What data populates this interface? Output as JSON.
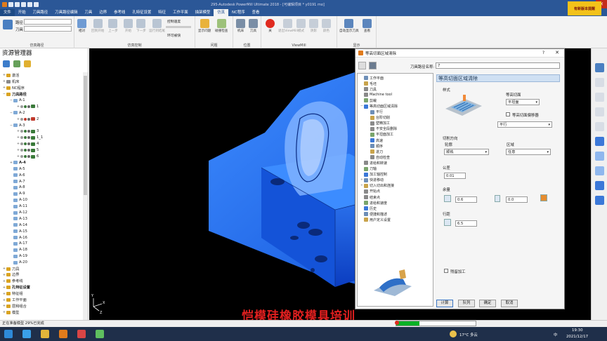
{
  "app": {
    "title": "295-Autodesk PowerMill Ultimate 2018  -  [可编辑项目 * y0191 mo]",
    "brand_banner": "有新版本提醒"
  },
  "menu": {
    "tabs": [
      "文件",
      "开始",
      "刀具路径",
      "刀具路径编辑",
      "刀具",
      "边界",
      "参考线",
      "孔特征设置",
      "特征",
      "工作平面",
      "描架模型",
      "仿真",
      "NC程序",
      "查看"
    ]
  },
  "ribbon": {
    "group_sim_path": {
      "label": "仿真路径",
      "row1": "路径",
      "row2": "刀具"
    },
    "group_sim_ctrl": {
      "label": "仿真控制",
      "buttons": [
        "相对",
        "回到开始",
        "上一步",
        "开始",
        "下一步",
        "运行到结尾"
      ],
      "speed": "控制速度",
      "loop": "环可被快"
    },
    "group_issue": {
      "label": "问题",
      "buttons": [
        "显示问题",
        "碰撞检查"
      ]
    },
    "group_pos": {
      "label": "位置",
      "buttons": [
        "机床",
        "刀具"
      ]
    },
    "group_viewmill": {
      "label": "ViewMill",
      "buttons": [
        "关",
        "退出ViewMill",
        "模式",
        "阴影",
        "颜色"
      ]
    },
    "group_display": {
      "label": "显示",
      "buttons": [
        "自动显示刀具",
        "查看"
      ]
    }
  },
  "explorer": {
    "title": "资源管理器",
    "items": [
      {
        "label": "激活",
        "depth": 0,
        "exp": "+",
        "c": "#d9a321"
      },
      {
        "label": "机床",
        "depth": 0,
        "exp": "+",
        "c": "#8a8a8a"
      },
      {
        "label": "NC程序",
        "depth": 0,
        "exp": "+",
        "c": "#d9a321"
      },
      {
        "label": "刀具路径",
        "depth": 0,
        "exp": "−",
        "c": "#d9a321",
        "bold": true
      },
      {
        "label": "A-1",
        "depth": 1,
        "exp": "−",
        "c": "#7fa9d6"
      },
      {
        "label": "1",
        "depth": 2,
        "exp": "+",
        "c": "#3a7a3a",
        "marks": true
      },
      {
        "label": "A-2",
        "depth": 1,
        "exp": "−",
        "c": "#7fa9d6"
      },
      {
        "label": "2",
        "depth": 2,
        "exp": "+",
        "c": "#c0392b",
        "marks": true
      },
      {
        "label": "A-3",
        "depth": 1,
        "exp": "−",
        "c": "#7fa9d6"
      },
      {
        "label": "3",
        "depth": 2,
        "exp": "+",
        "c": "#3a7a3a",
        "marks": true
      },
      {
        "label": "1_1",
        "depth": 2,
        "exp": "+",
        "c": "#3a7a3a",
        "marks": true
      },
      {
        "label": "4",
        "depth": 2,
        "exp": "+",
        "c": "#3a7a3a",
        "marks": true
      },
      {
        "label": "5",
        "depth": 2,
        "exp": "+",
        "c": "#3a7a3a",
        "marks": true
      },
      {
        "label": "6",
        "depth": 2,
        "exp": "+",
        "c": "#3a7a3a",
        "marks": true
      },
      {
        "label": "A-4",
        "depth": 1,
        "exp": "+",
        "c": "#7fa9d6",
        "bold": true
      },
      {
        "label": "A-5",
        "depth": 1,
        "exp": "",
        "c": "#7fa9d6"
      },
      {
        "label": "A-6",
        "depth": 1,
        "exp": "",
        "c": "#7fa9d6"
      },
      {
        "label": "A-7",
        "depth": 1,
        "exp": "",
        "c": "#7fa9d6"
      },
      {
        "label": "A-8",
        "depth": 1,
        "exp": "",
        "c": "#7fa9d6"
      },
      {
        "label": "A-9",
        "depth": 1,
        "exp": "",
        "c": "#7fa9d6"
      },
      {
        "label": "A-10",
        "depth": 1,
        "exp": "",
        "c": "#7fa9d6"
      },
      {
        "label": "A-11",
        "depth": 1,
        "exp": "",
        "c": "#7fa9d6"
      },
      {
        "label": "A-12",
        "depth": 1,
        "exp": "",
        "c": "#7fa9d6"
      },
      {
        "label": "A-13",
        "depth": 1,
        "exp": "",
        "c": "#7fa9d6"
      },
      {
        "label": "A-14",
        "depth": 1,
        "exp": "",
        "c": "#7fa9d6"
      },
      {
        "label": "A-15",
        "depth": 1,
        "exp": "",
        "c": "#7fa9d6"
      },
      {
        "label": "A-16",
        "depth": 1,
        "exp": "",
        "c": "#7fa9d6"
      },
      {
        "label": "A-17",
        "depth": 1,
        "exp": "",
        "c": "#7fa9d6"
      },
      {
        "label": "A-18",
        "depth": 1,
        "exp": "",
        "c": "#7fa9d6"
      },
      {
        "label": "A-19",
        "depth": 1,
        "exp": "",
        "c": "#7fa9d6"
      },
      {
        "label": "A-20",
        "depth": 1,
        "exp": "",
        "c": "#7fa9d6"
      },
      {
        "label": "刀具",
        "depth": 0,
        "exp": "+",
        "c": "#d9a321"
      },
      {
        "label": "边界",
        "depth": 0,
        "exp": "+",
        "c": "#d9a321"
      },
      {
        "label": "参考线",
        "depth": 0,
        "exp": "+",
        "c": "#d9a321"
      },
      {
        "label": "孔特征设置",
        "depth": 0,
        "exp": "+",
        "c": "#d9a321",
        "bold": true
      },
      {
        "label": "特征组",
        "depth": 0,
        "exp": "+",
        "c": "#d9a321"
      },
      {
        "label": "工作平面",
        "depth": 0,
        "exp": "+",
        "c": "#d9a321"
      },
      {
        "label": "层和组合",
        "depth": 0,
        "exp": "+",
        "c": "#d9a321"
      },
      {
        "label": "模型",
        "depth": 0,
        "exp": "+",
        "c": "#d9a321"
      }
    ]
  },
  "dialog": {
    "title": "等高切面区域清除",
    "help": "?",
    "close": "✕",
    "toolpath_name_label": "刀具路径名称:",
    "toolpath_name": "7",
    "nav": [
      {
        "label": "工作平面",
        "d": 0,
        "ex": ""
      },
      {
        "label": "毛坯",
        "d": 0,
        "ex": ""
      },
      {
        "label": "刀具",
        "d": 0,
        "ex": ""
      },
      {
        "label": "Machine tool",
        "d": 0,
        "ex": ""
      },
      {
        "label": "剪裁",
        "d": 0,
        "ex": ""
      },
      {
        "label": "等高切面区域清除",
        "d": 0,
        "ex": "−"
      },
      {
        "label": "平行",
        "d": 1,
        "ex": ""
      },
      {
        "label": "台阶切削",
        "d": 1,
        "ex": ""
      },
      {
        "label": "壁精加工",
        "d": 1,
        "ex": ""
      },
      {
        "label": "不安全段删除",
        "d": 1,
        "ex": ""
      },
      {
        "label": "平坦面加工",
        "d": 1,
        "ex": ""
      },
      {
        "label": "高速",
        "d": 1,
        "ex": ""
      },
      {
        "label": "顺序",
        "d": 1,
        "ex": ""
      },
      {
        "label": "进刀",
        "d": 1,
        "ex": ""
      },
      {
        "label": "自动检查",
        "d": 1,
        "ex": ""
      },
      {
        "label": "进给和转速",
        "d": 0,
        "ex": ""
      },
      {
        "label": "刀轴",
        "d": 0,
        "ex": ""
      },
      {
        "label": "加工轴控制",
        "d": 0,
        "ex": ""
      },
      {
        "label": "快进移动",
        "d": 0,
        "ex": "+"
      },
      {
        "label": "切入切出和连接",
        "d": 0,
        "ex": "+"
      },
      {
        "label": "开始点",
        "d": 0,
        "ex": ""
      },
      {
        "label": "结束点",
        "d": 0,
        "ex": ""
      },
      {
        "label": "进给和速度",
        "d": 0,
        "ex": ""
      },
      {
        "label": "历史",
        "d": 0,
        "ex": ""
      },
      {
        "label": "便捷和描述",
        "d": 0,
        "ex": ""
      },
      {
        "label": "用户定义设置",
        "d": 0,
        "ex": ""
      }
    ],
    "panel_title": "等高切面区域清除",
    "style_label": "样式",
    "contour_label": "等高切面",
    "contour_value": "平坦面",
    "contour_check": "等高切面偏移器",
    "style_value": "平行",
    "cut_dir_label": "切削方向",
    "profile_label": "轮廓",
    "profile_value": "顺铣",
    "area_label": "区域",
    "area_value": "任意",
    "tolerance_label": "公差",
    "tolerance_value": "0.01",
    "allowance_label": "余量",
    "allowance_radial": "0.6",
    "allowance_axial": "0.0",
    "stepover_label": "行距",
    "stepover_value": "6.5",
    "rough_check": "残留加工",
    "buttons": {
      "calc": "计算",
      "queue": "队列",
      "ok": "确定",
      "cancel": "取消"
    }
  },
  "overlay_text": "恺模硅橡胶模具培训",
  "status": {
    "text": "正在准备模型  29%已完成",
    "progress": 0.29
  },
  "taskbar": {
    "weather": "17°C 多云",
    "time": "19:30",
    "date": "2021/12/17",
    "lang": "中"
  }
}
